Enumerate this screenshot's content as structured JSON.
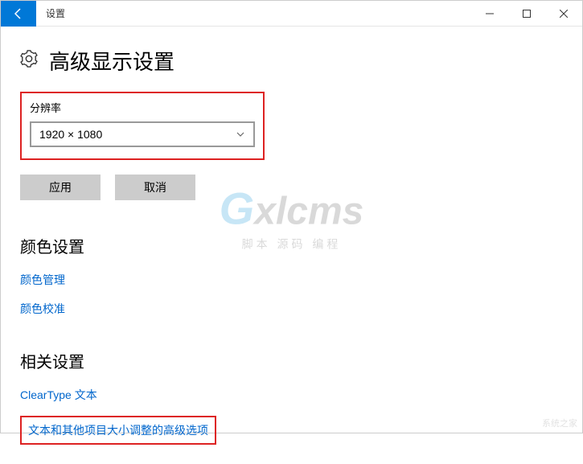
{
  "window": {
    "title": "设置"
  },
  "page": {
    "heading": "高级显示设置"
  },
  "resolution": {
    "label": "分辨率",
    "value": "1920 × 1080"
  },
  "buttons": {
    "apply": "应用",
    "cancel": "取消"
  },
  "color_section": {
    "heading": "颜色设置",
    "links": {
      "management": "颜色管理",
      "calibration": "颜色校准"
    }
  },
  "related_section": {
    "heading": "相关设置",
    "links": {
      "cleartype": "ClearType 文本",
      "advanced_sizing": "文本和其他项目大小调整的高级选项"
    }
  },
  "watermark": {
    "g": "G",
    "rest": "xlcms",
    "sub": "脚本 源码 编程",
    "corner": "系统之家"
  }
}
